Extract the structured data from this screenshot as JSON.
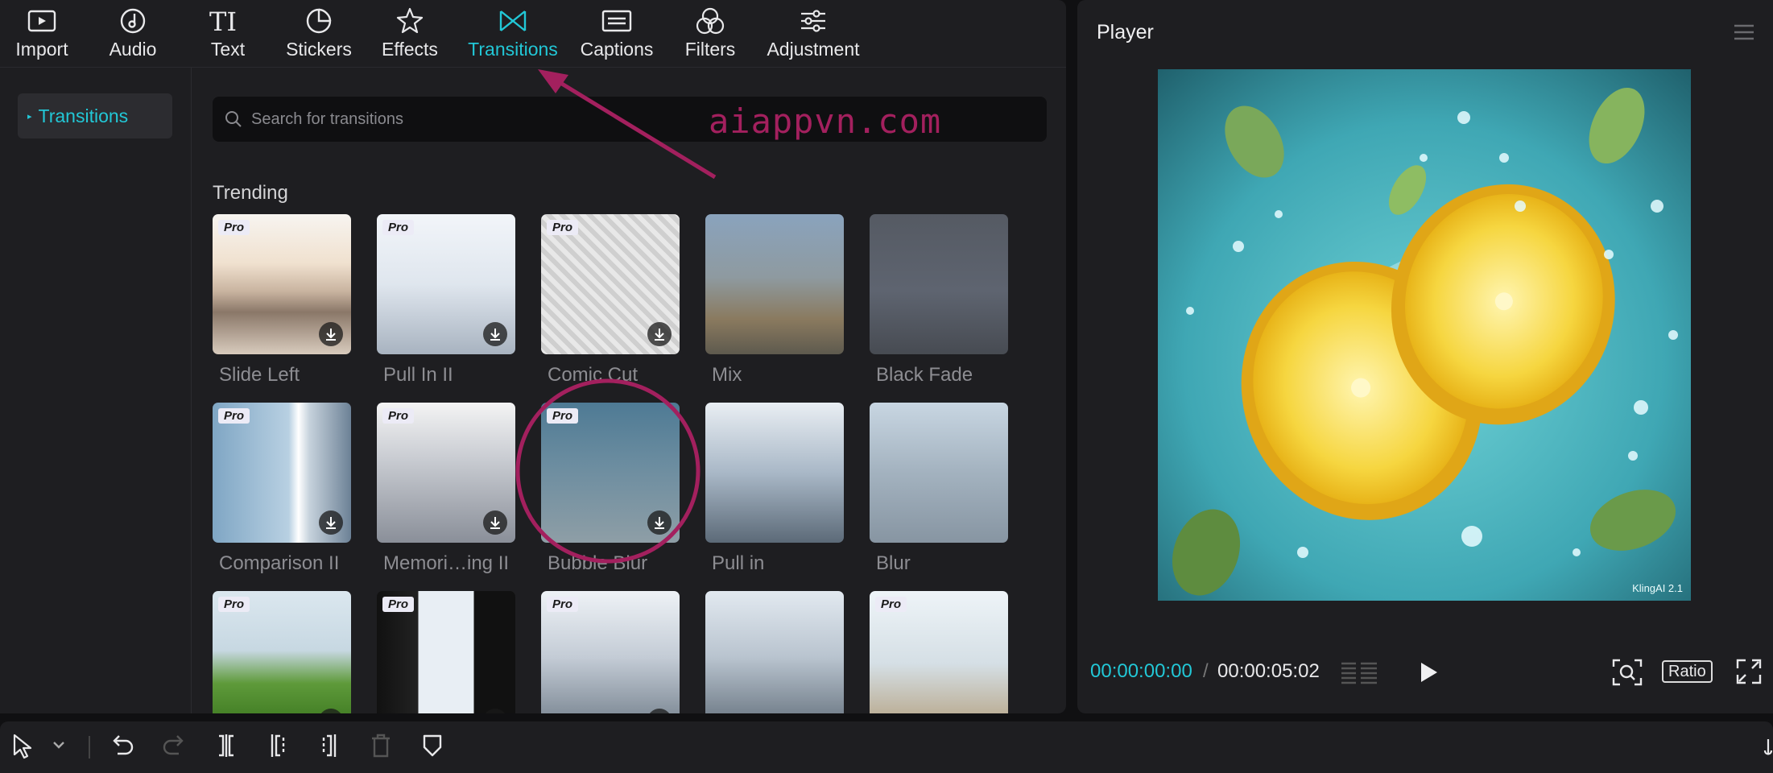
{
  "toolbar": {
    "items": [
      {
        "label": "Import",
        "icon": "import-icon"
      },
      {
        "label": "Audio",
        "icon": "audio-icon"
      },
      {
        "label": "Text",
        "icon": "text-icon"
      },
      {
        "label": "Stickers",
        "icon": "stickers-icon"
      },
      {
        "label": "Effects",
        "icon": "effects-icon"
      },
      {
        "label": "Transitions",
        "icon": "transitions-icon",
        "active": true
      },
      {
        "label": "Captions",
        "icon": "captions-icon"
      },
      {
        "label": "Filters",
        "icon": "filters-icon"
      },
      {
        "label": "Adjustment",
        "icon": "adjustment-icon"
      }
    ]
  },
  "sidebar": {
    "items": [
      {
        "label": "Transitions",
        "selected": true
      }
    ]
  },
  "search": {
    "placeholder": "Search for transitions",
    "value": ""
  },
  "watermark": "aiappvn.com",
  "section": {
    "title": "Trending"
  },
  "cards": [
    {
      "name": "Slide Left",
      "pro": true,
      "download": true
    },
    {
      "name": "Pull In II",
      "pro": true,
      "download": true
    },
    {
      "name": "Comic Cut",
      "pro": true,
      "download": true
    },
    {
      "name": "Mix",
      "pro": false,
      "download": false
    },
    {
      "name": "Black Fade",
      "pro": false,
      "download": false
    },
    {
      "name": "Comparison II",
      "pro": true,
      "download": true
    },
    {
      "name": "Memori…ing II",
      "pro": true,
      "download": true
    },
    {
      "name": "Bubble Blur",
      "pro": true,
      "download": true
    },
    {
      "name": "Pull in",
      "pro": false,
      "download": false
    },
    {
      "name": "Blur",
      "pro": false,
      "download": false
    },
    {
      "name": "",
      "pro": true,
      "download": true
    },
    {
      "name": "",
      "pro": true,
      "download": true
    },
    {
      "name": "",
      "pro": true,
      "download": true
    },
    {
      "name": "",
      "pro": false,
      "download": false
    },
    {
      "name": "",
      "pro": true,
      "download": false
    }
  ],
  "pro_badge": "Pro",
  "player": {
    "title": "Player",
    "current_time": "00:00:00:00",
    "separator": "/",
    "total_time": "00:00:05:02",
    "ratio_label": "Ratio",
    "video_watermark": "KlingAI 2.1"
  },
  "colors": {
    "accent": "#22c7d6",
    "annotation": "#a3205e",
    "panel": "#1e1e21",
    "background": "#101012"
  }
}
